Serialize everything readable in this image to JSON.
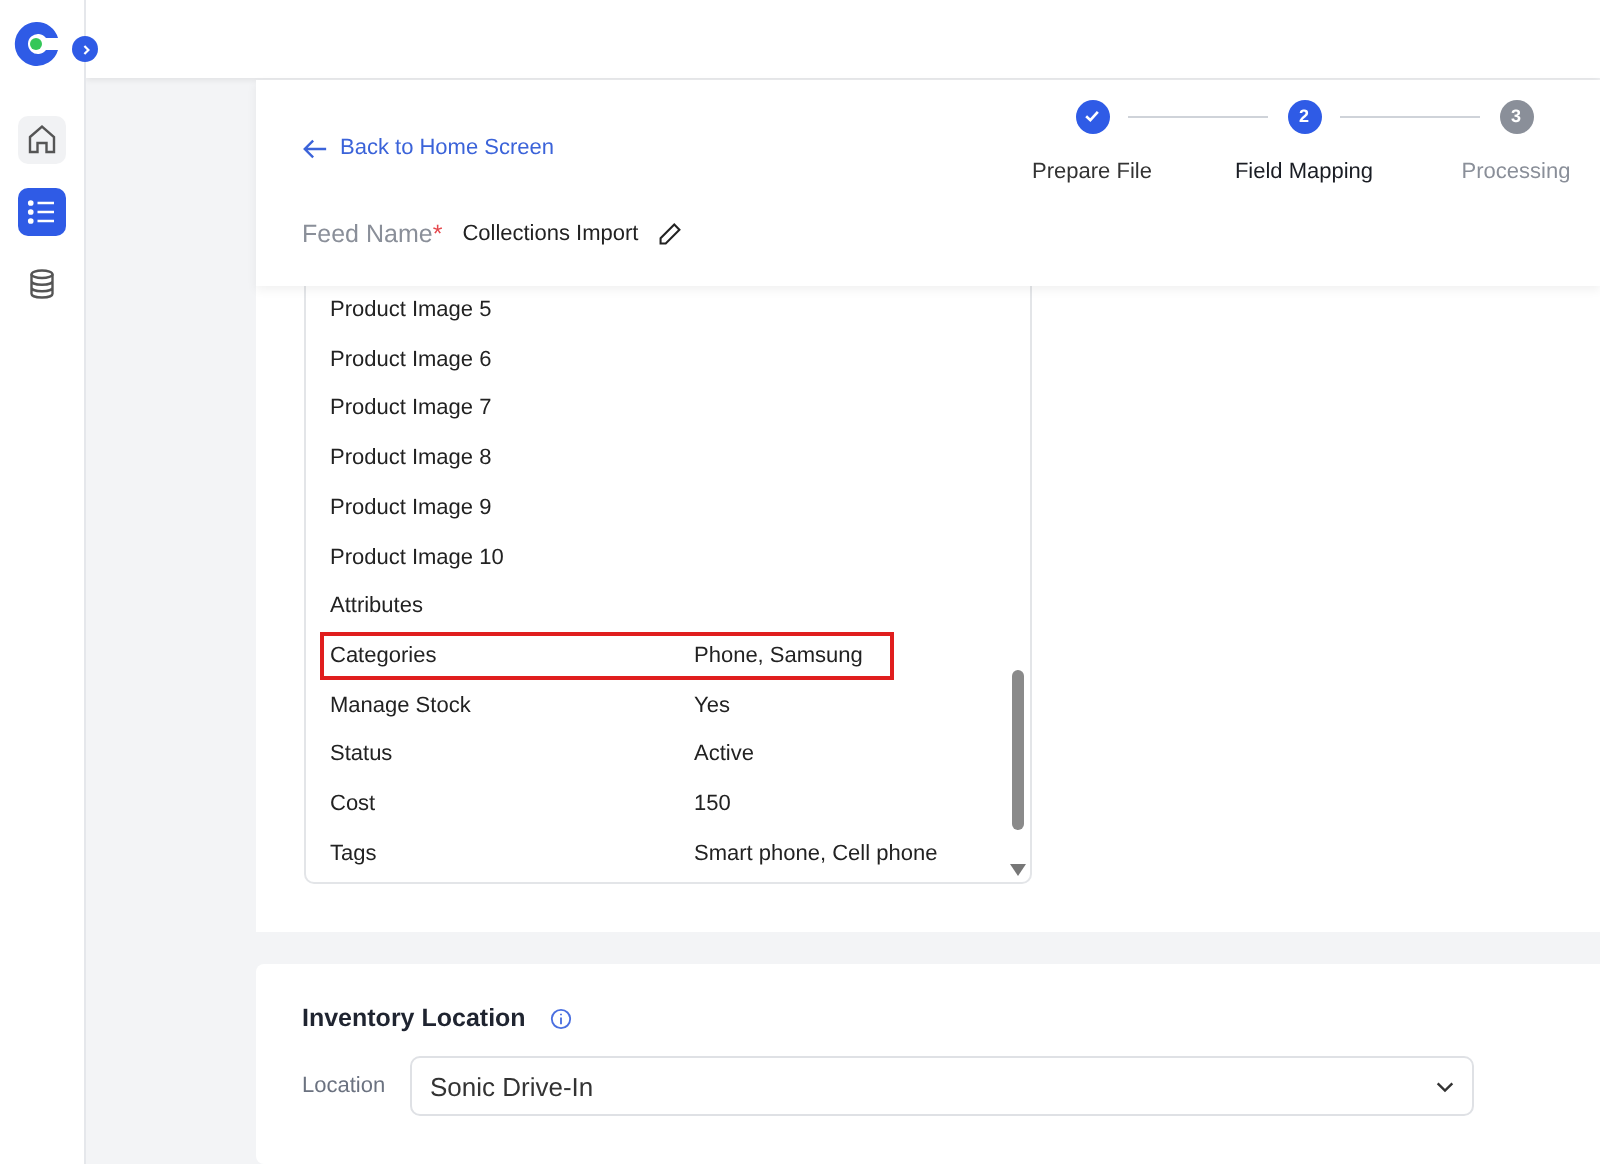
{
  "sidebar": {
    "items": [
      {
        "kind": "home",
        "selected": false
      },
      {
        "kind": "list",
        "selected": true
      },
      {
        "kind": "database",
        "selected": false
      }
    ]
  },
  "header": {
    "back_link": "Back to Home Screen",
    "steps": [
      {
        "label": "Prepare File",
        "completed": true,
        "active": false
      },
      {
        "label": "Field Mapping",
        "completed": false,
        "active": true,
        "number": "2"
      },
      {
        "label": "Processing",
        "completed": false,
        "active": false,
        "number": "3"
      }
    ],
    "feed_name": {
      "label": "Feed Name",
      "required_mark": "*",
      "value": "Collections Import"
    }
  },
  "mapping": {
    "rows": [
      {
        "field": "Product Image 5",
        "highlighted": false
      },
      {
        "field": "Product Image 6",
        "highlighted": false
      },
      {
        "field": "Product Image 7",
        "highlighted": false
      },
      {
        "field": "Product Image 8",
        "highlighted": false
      },
      {
        "field": "Product Image 9",
        "highlighted": false
      },
      {
        "field": "Product Image 10",
        "highlighted": false
      },
      {
        "field": "Attributes",
        "highlighted": false
      },
      {
        "field": "Categories",
        "value": "Phone, Samsung",
        "highlighted": true
      },
      {
        "field": "Manage Stock",
        "value": "Yes",
        "highlighted": false
      },
      {
        "field": "Status",
        "value": "Active",
        "highlighted": false
      },
      {
        "field": "Cost",
        "value": "150",
        "highlighted": false
      },
      {
        "field": "Tags",
        "value": "Smart phone, Cell phone",
        "highlighted": false
      }
    ]
  },
  "inventory": {
    "title": "Inventory Location",
    "location_label": "Location",
    "location_value": "Sonic Drive-In"
  }
}
